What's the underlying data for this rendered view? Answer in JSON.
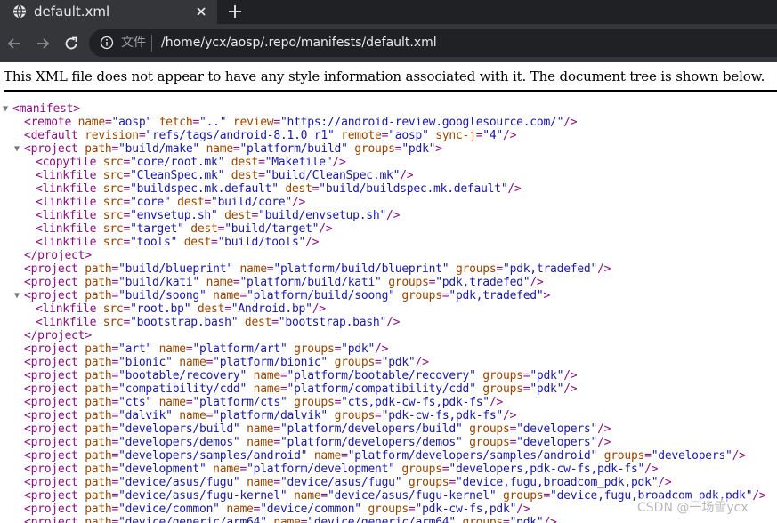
{
  "browser": {
    "tab_title": "default.xml",
    "new_tab_label": "+",
    "address_scheme": "文件",
    "address_url": "/home/ycx/aosp/.repo/manifests/default.xml"
  },
  "page": {
    "notice": "This XML file does not appear to have any style information associated with it. The document tree is shown below.",
    "tree_lines": [
      {
        "indent": 0,
        "toggle": "▼",
        "tag": "manifest",
        "attrs": [],
        "end": ">"
      },
      {
        "indent": 1,
        "tag": "remote",
        "attrs": [
          [
            "name",
            "aosp"
          ],
          [
            "fetch",
            ".."
          ],
          [
            "review",
            "https://android-review.googlesource.com/"
          ]
        ],
        "end": "/>"
      },
      {
        "indent": 1,
        "tag": "default",
        "attrs": [
          [
            "revision",
            "refs/tags/android-8.1.0_r1"
          ],
          [
            "remote",
            "aosp"
          ],
          [
            "sync-j",
            "4"
          ]
        ],
        "end": "/>"
      },
      {
        "indent": 1,
        "toggle": "▼",
        "tag": "project",
        "attrs": [
          [
            "path",
            "build/make"
          ],
          [
            "name",
            "platform/build"
          ],
          [
            "groups",
            "pdk"
          ]
        ],
        "end": ">"
      },
      {
        "indent": 2,
        "tag": "copyfile",
        "attrs": [
          [
            "src",
            "core/root.mk"
          ],
          [
            "dest",
            "Makefile"
          ]
        ],
        "end": "/>"
      },
      {
        "indent": 2,
        "tag": "linkfile",
        "attrs": [
          [
            "src",
            "CleanSpec.mk"
          ],
          [
            "dest",
            "build/CleanSpec.mk"
          ]
        ],
        "end": "/>"
      },
      {
        "indent": 2,
        "tag": "linkfile",
        "attrs": [
          [
            "src",
            "buildspec.mk.default"
          ],
          [
            "dest",
            "build/buildspec.mk.default"
          ]
        ],
        "end": "/>"
      },
      {
        "indent": 2,
        "tag": "linkfile",
        "attrs": [
          [
            "src",
            "core"
          ],
          [
            "dest",
            "build/core"
          ]
        ],
        "end": "/>"
      },
      {
        "indent": 2,
        "tag": "linkfile",
        "attrs": [
          [
            "src",
            "envsetup.sh"
          ],
          [
            "dest",
            "build/envsetup.sh"
          ]
        ],
        "end": "/>"
      },
      {
        "indent": 2,
        "tag": "linkfile",
        "attrs": [
          [
            "src",
            "target"
          ],
          [
            "dest",
            "build/target"
          ]
        ],
        "end": "/>"
      },
      {
        "indent": 2,
        "tag": "linkfile",
        "attrs": [
          [
            "src",
            "tools"
          ],
          [
            "dest",
            "build/tools"
          ]
        ],
        "end": "/>"
      },
      {
        "indent": 1,
        "close": "project"
      },
      {
        "indent": 1,
        "tag": "project",
        "attrs": [
          [
            "path",
            "build/blueprint"
          ],
          [
            "name",
            "platform/build/blueprint"
          ],
          [
            "groups",
            "pdk,tradefed"
          ]
        ],
        "end": "/>"
      },
      {
        "indent": 1,
        "tag": "project",
        "attrs": [
          [
            "path",
            "build/kati"
          ],
          [
            "name",
            "platform/build/kati"
          ],
          [
            "groups",
            "pdk,tradefed"
          ]
        ],
        "end": "/>"
      },
      {
        "indent": 1,
        "toggle": "▼",
        "tag": "project",
        "attrs": [
          [
            "path",
            "build/soong"
          ],
          [
            "name",
            "platform/build/soong"
          ],
          [
            "groups",
            "pdk,tradefed"
          ]
        ],
        "end": ">"
      },
      {
        "indent": 2,
        "tag": "linkfile",
        "attrs": [
          [
            "src",
            "root.bp"
          ],
          [
            "dest",
            "Android.bp"
          ]
        ],
        "end": "/>"
      },
      {
        "indent": 2,
        "tag": "linkfile",
        "attrs": [
          [
            "src",
            "bootstrap.bash"
          ],
          [
            "dest",
            "bootstrap.bash"
          ]
        ],
        "end": "/>"
      },
      {
        "indent": 1,
        "close": "project"
      },
      {
        "indent": 1,
        "tag": "project",
        "attrs": [
          [
            "path",
            "art"
          ],
          [
            "name",
            "platform/art"
          ],
          [
            "groups",
            "pdk"
          ]
        ],
        "end": "/>"
      },
      {
        "indent": 1,
        "tag": "project",
        "attrs": [
          [
            "path",
            "bionic"
          ],
          [
            "name",
            "platform/bionic"
          ],
          [
            "groups",
            "pdk"
          ]
        ],
        "end": "/>"
      },
      {
        "indent": 1,
        "tag": "project",
        "attrs": [
          [
            "path",
            "bootable/recovery"
          ],
          [
            "name",
            "platform/bootable/recovery"
          ],
          [
            "groups",
            "pdk"
          ]
        ],
        "end": "/>"
      },
      {
        "indent": 1,
        "tag": "project",
        "attrs": [
          [
            "path",
            "compatibility/cdd"
          ],
          [
            "name",
            "platform/compatibility/cdd"
          ],
          [
            "groups",
            "pdk"
          ]
        ],
        "end": "/>"
      },
      {
        "indent": 1,
        "tag": "project",
        "attrs": [
          [
            "path",
            "cts"
          ],
          [
            "name",
            "platform/cts"
          ],
          [
            "groups",
            "cts,pdk-cw-fs,pdk-fs"
          ]
        ],
        "end": "/>"
      },
      {
        "indent": 1,
        "tag": "project",
        "attrs": [
          [
            "path",
            "dalvik"
          ],
          [
            "name",
            "platform/dalvik"
          ],
          [
            "groups",
            "pdk-cw-fs,pdk-fs"
          ]
        ],
        "end": "/>"
      },
      {
        "indent": 1,
        "tag": "project",
        "attrs": [
          [
            "path",
            "developers/build"
          ],
          [
            "name",
            "platform/developers/build"
          ],
          [
            "groups",
            "developers"
          ]
        ],
        "end": "/>"
      },
      {
        "indent": 1,
        "tag": "project",
        "attrs": [
          [
            "path",
            "developers/demos"
          ],
          [
            "name",
            "platform/developers/demos"
          ],
          [
            "groups",
            "developers"
          ]
        ],
        "end": "/>"
      },
      {
        "indent": 1,
        "tag": "project",
        "attrs": [
          [
            "path",
            "developers/samples/android"
          ],
          [
            "name",
            "platform/developers/samples/android"
          ],
          [
            "groups",
            "developers"
          ]
        ],
        "end": "/>"
      },
      {
        "indent": 1,
        "tag": "project",
        "attrs": [
          [
            "path",
            "development"
          ],
          [
            "name",
            "platform/development"
          ],
          [
            "groups",
            "developers,pdk-cw-fs,pdk-fs"
          ]
        ],
        "end": "/>"
      },
      {
        "indent": 1,
        "tag": "project",
        "attrs": [
          [
            "path",
            "device/asus/fugu"
          ],
          [
            "name",
            "device/asus/fugu"
          ],
          [
            "groups",
            "device,fugu,broadcom_pdk,pdk"
          ]
        ],
        "end": "/>"
      },
      {
        "indent": 1,
        "tag": "project",
        "attrs": [
          [
            "path",
            "device/asus/fugu-kernel"
          ],
          [
            "name",
            "device/asus/fugu-kernel"
          ],
          [
            "groups",
            "device,fugu,broadcom_pdk,pdk"
          ]
        ],
        "end": "/>"
      },
      {
        "indent": 1,
        "tag": "project",
        "attrs": [
          [
            "path",
            "device/common"
          ],
          [
            "name",
            "device/common"
          ],
          [
            "groups",
            "pdk-cw-fs,pdk"
          ]
        ],
        "end": "/>"
      },
      {
        "indent": 1,
        "tag": "project",
        "attrs": [
          [
            "path",
            "device/generic/arm64"
          ],
          [
            "name",
            "device/generic/arm64"
          ],
          [
            "groups",
            "pdk"
          ]
        ],
        "end": "/>"
      }
    ]
  },
  "watermark": "CSDN @一场雪ycx",
  "colors": {
    "tag": "#881280",
    "attr_name": "#994500",
    "attr_value": "#1a1aa6",
    "chrome_dark": "#202124",
    "chrome_tab": "#35363a"
  }
}
